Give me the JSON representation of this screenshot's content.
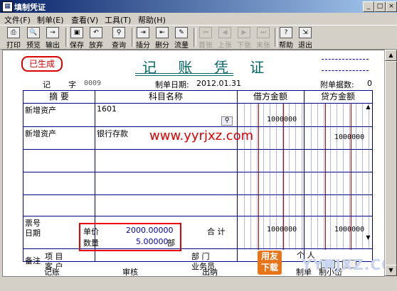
{
  "window": {
    "title": "填制凭证",
    "buttons": [
      "_",
      "□",
      "×"
    ]
  },
  "menu": [
    "文件(F)",
    "制单(E)",
    "查看(V)",
    "工具(T)",
    "帮助(H)"
  ],
  "toolbar": [
    {
      "label": "打印",
      "icon": "print-icon",
      "enabled": true
    },
    {
      "label": "预览",
      "icon": "preview-icon",
      "enabled": true
    },
    {
      "label": "输出",
      "icon": "export-icon",
      "enabled": true
    },
    {
      "label": "保存",
      "icon": "save-icon",
      "enabled": true
    },
    {
      "label": "放弃",
      "icon": "undo-icon",
      "enabled": true
    },
    {
      "label": "查询",
      "icon": "binoculars-icon",
      "enabled": true
    },
    {
      "label": "插分",
      "icon": "insert-row-icon",
      "enabled": true
    },
    {
      "label": "删分",
      "icon": "delete-row-icon",
      "enabled": true
    },
    {
      "label": "流量",
      "icon": "flow-icon",
      "enabled": true
    },
    {
      "label": "首张",
      "icon": "first-icon",
      "enabled": false
    },
    {
      "label": "上张",
      "icon": "prev-icon",
      "enabled": false
    },
    {
      "label": "下张",
      "icon": "next-icon",
      "enabled": false
    },
    {
      "label": "末张",
      "icon": "last-icon",
      "enabled": false
    },
    {
      "label": "帮助",
      "icon": "help-icon",
      "enabled": true
    },
    {
      "label": "退出",
      "icon": "exit-icon",
      "enabled": true
    }
  ],
  "voucher": {
    "stamp": "已生成",
    "title": "记 账 凭 证",
    "type_label": "记",
    "zi_label": "字",
    "number": "0009",
    "date_label": "制单日期:",
    "date": "2012.01.31",
    "attach_label": "附单据数:",
    "attach_value": "0",
    "headers": {
      "summary": "摘  要",
      "account": "科目名称",
      "debit": "借方金额",
      "credit": "贷方金额"
    },
    "rows": [
      {
        "summary": "新增资产",
        "account": "1601",
        "debit": "1000000",
        "credit": ""
      },
      {
        "summary": "新增资产",
        "account": "银行存款",
        "debit": "",
        "credit": "1000000"
      }
    ],
    "bill_no_label": "票号",
    "date_row_label": "日期",
    "price_label": "单价",
    "price_value": "2000.00000",
    "qty_label": "数量",
    "qty_value": "5.00000",
    "qty_unit": "部",
    "total_label": "合 计",
    "total_debit": "1000000",
    "total_credit": "1000000",
    "note_label": "备注",
    "project_label": "项   目",
    "customer_label": "客   户",
    "dept_label": "部   门",
    "staff_label": "业务员",
    "person_label": "个  人",
    "watermark_url": "www.yyrjxz.com",
    "footer": {
      "bookkeeper": "记账",
      "auditor": "审核",
      "cashier": "出纳",
      "maker": "制单",
      "maker_name": "制小岱"
    }
  },
  "brand": {
    "logo_text": "用友下载",
    "logo_url": "YYRJXZ.COM"
  },
  "colors": {
    "stamp": "#dd0000",
    "table_line": "#00008b",
    "money_red": "#c00000",
    "money_blue": "#0000aa"
  }
}
